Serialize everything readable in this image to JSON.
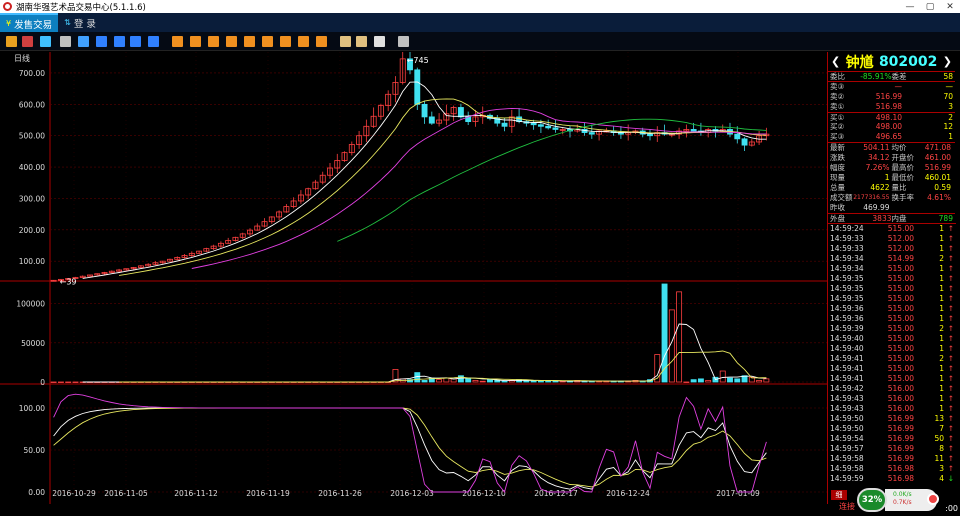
{
  "window": {
    "title": "湖南华强艺术品交易中心(5.1.1.6)",
    "controls": [
      "—",
      "▢",
      "✕"
    ]
  },
  "menu": {
    "items": [
      {
        "label": "发售交易",
        "icon": "¥"
      },
      {
        "label": "登  录",
        "icon": "⇅"
      }
    ]
  },
  "toolbar": {
    "buttons": [
      {
        "name": "bar-chart-icon",
        "color": "#e8a020"
      },
      {
        "name": "line-chart-icon",
        "color": "#d04040"
      },
      {
        "name": "candle-icon",
        "color": "#40c0ff"
      },
      {
        "name": "calc-icon",
        "color": "#c0c0c0"
      },
      {
        "name": "grid-icon",
        "color": "#40a0ff"
      },
      {
        "name": "k1-icon",
        "color": "#3080ff"
      },
      {
        "name": "k2-icon",
        "color": "#3080ff"
      },
      {
        "name": "k3-icon",
        "color": "#3080ff"
      },
      {
        "name": "k4-icon",
        "color": "#3080ff"
      },
      {
        "name": "p1-icon",
        "color": "#f09020"
      },
      {
        "name": "p2-icon",
        "color": "#f09020"
      },
      {
        "name": "p3-icon",
        "color": "#f09020"
      },
      {
        "name": "p4-icon",
        "color": "#f09020"
      },
      {
        "name": "p5-icon",
        "color": "#f09020"
      },
      {
        "name": "p6-icon",
        "color": "#f09020"
      },
      {
        "name": "p7-icon",
        "color": "#f09020"
      },
      {
        "name": "p8-icon",
        "color": "#f09020"
      },
      {
        "name": "p9-icon",
        "color": "#f09020"
      },
      {
        "name": "zoom-in-icon",
        "color": "#e0c080"
      },
      {
        "name": "zoom-out-icon",
        "color": "#e0c080"
      },
      {
        "name": "draw-icon",
        "color": "#e0e0e0"
      },
      {
        "name": "settings-icon",
        "color": "#c0c0c0"
      }
    ]
  },
  "product": {
    "name": "钟馗",
    "code": "802002"
  },
  "order_book": {
    "wei_bi_label": "委比",
    "wei_bi": "-85.91%",
    "wei_cha_label": "委差",
    "wei_cha": "58",
    "sell": [
      {
        "label": "卖③",
        "price": "—",
        "qty": "—"
      },
      {
        "label": "卖②",
        "price": "516.99",
        "qty": "70"
      },
      {
        "label": "卖①",
        "price": "516.98",
        "qty": "3"
      }
    ],
    "buy": [
      {
        "label": "买①",
        "price": "498.10",
        "qty": "2"
      },
      {
        "label": "买②",
        "price": "498.00",
        "qty": "12"
      },
      {
        "label": "买③",
        "price": "496.65",
        "qty": "1"
      }
    ]
  },
  "stats": [
    {
      "k1": "最新",
      "v1": "504.11",
      "k2": "均价",
      "v2": "471.08"
    },
    {
      "k1": "涨跌",
      "v1": "34.12",
      "k2": "开盘价",
      "v2": "461.00"
    },
    {
      "k1": "幅度",
      "v1": "7.26%",
      "k2": "最高价",
      "v2": "516.99"
    },
    {
      "k1": "现量",
      "v1": "1",
      "k2": "最低价",
      "v2": "460.01"
    },
    {
      "k1": "总量",
      "v1": "4622",
      "k2": "量比",
      "v2": "0.59"
    },
    {
      "k1": "成交额",
      "v1": "2177316.55",
      "k2": "换手率",
      "v2": "4.61%"
    },
    {
      "k1": "昨收",
      "v1": "469.99",
      "k2": "",
      "v2": ""
    }
  ],
  "outer_inner": {
    "out_label": "外盘",
    "out_val": "3833",
    "in_label": "内盘",
    "in_val": "789"
  },
  "trades": [
    {
      "time": "14:59:24",
      "price": "515.00",
      "vol": "1",
      "dir": "up"
    },
    {
      "time": "14:59:33",
      "price": "512.00",
      "vol": "1",
      "dir": "up"
    },
    {
      "time": "14:59:33",
      "price": "512.00",
      "vol": "1",
      "dir": "up"
    },
    {
      "time": "14:59:34",
      "price": "514.99",
      "vol": "2",
      "dir": "up"
    },
    {
      "time": "14:59:34",
      "price": "515.00",
      "vol": "1",
      "dir": "up"
    },
    {
      "time": "14:59:35",
      "price": "515.00",
      "vol": "1",
      "dir": "up"
    },
    {
      "time": "14:59:35",
      "price": "515.00",
      "vol": "1",
      "dir": "up"
    },
    {
      "time": "14:59:35",
      "price": "515.00",
      "vol": "1",
      "dir": "up"
    },
    {
      "time": "14:59:36",
      "price": "515.00",
      "vol": "1",
      "dir": "up"
    },
    {
      "time": "14:59:36",
      "price": "515.00",
      "vol": "1",
      "dir": "up"
    },
    {
      "time": "14:59:39",
      "price": "515.00",
      "vol": "2",
      "dir": "up"
    },
    {
      "time": "14:59:40",
      "price": "515.00",
      "vol": "1",
      "dir": "up"
    },
    {
      "time": "14:59:40",
      "price": "515.00",
      "vol": "1",
      "dir": "up"
    },
    {
      "time": "14:59:41",
      "price": "515.00",
      "vol": "2",
      "dir": "up"
    },
    {
      "time": "14:59:41",
      "price": "515.00",
      "vol": "1",
      "dir": "up"
    },
    {
      "time": "14:59:41",
      "price": "515.00",
      "vol": "1",
      "dir": "up"
    },
    {
      "time": "14:59:42",
      "price": "516.00",
      "vol": "1",
      "dir": "up"
    },
    {
      "time": "14:59:43",
      "price": "516.00",
      "vol": "1",
      "dir": "up"
    },
    {
      "time": "14:59:43",
      "price": "516.00",
      "vol": "1",
      "dir": "up"
    },
    {
      "time": "14:59:50",
      "price": "516.99",
      "vol": "13",
      "dir": "up"
    },
    {
      "time": "14:59:50",
      "price": "516.99",
      "vol": "7",
      "dir": "up"
    },
    {
      "time": "14:59:54",
      "price": "516.99",
      "vol": "50",
      "dir": "up"
    },
    {
      "time": "14:59:57",
      "price": "516.99",
      "vol": "8",
      "dir": "up"
    },
    {
      "time": "14:59:58",
      "price": "516.99",
      "vol": "11",
      "dir": "up"
    },
    {
      "time": "14:59:58",
      "price": "516.98",
      "vol": "3",
      "dir": "up"
    },
    {
      "time": "14:59:59",
      "price": "516.98",
      "vol": "4",
      "dir": "down"
    }
  ],
  "footer": {
    "tab": "细",
    "label": "连接",
    "gauge": "32%",
    "net_up": "0.0K/s",
    "net_down": "0.7K/s",
    "clock": ":00"
  },
  "chart_data": {
    "type": "candlestick",
    "period_label": "日线",
    "x_ticks": [
      "2016-10-29",
      "2016-11-05",
      "2016-11-12",
      "2016-11-19",
      "2016-11-26",
      "2016-12-03",
      "2016-12-10",
      "2016-12-17",
      "2016-12-24",
      "2017-01-09"
    ],
    "price_axis": {
      "ticks": [
        "700.00",
        "600.00",
        "500.00",
        "400.00",
        "300.00",
        "200.00",
        "100.00"
      ],
      "values": [
        700,
        600,
        500,
        400,
        300,
        200,
        100
      ],
      "min": 40,
      "max": 735
    },
    "volume_axis": {
      "ticks": [
        "100000",
        "50000",
        "0"
      ],
      "values": [
        100000,
        50000,
        0
      ],
      "max": 125000
    },
    "osc_axis": {
      "ticks": [
        "100.00",
        "50.00",
        "0.00"
      ],
      "values": [
        100,
        50,
        0
      ],
      "min": 0,
      "max": 125
    },
    "annotations": {
      "high": "745",
      "low": "39"
    },
    "closes": [
      39,
      42,
      45,
      48,
      52,
      56,
      60,
      64,
      68,
      72,
      76,
      80,
      85,
      90,
      95,
      100,
      106,
      112,
      118,
      125,
      132,
      140,
      148,
      157,
      166,
      176,
      187,
      199,
      212,
      226,
      241,
      257,
      274,
      292,
      311,
      331,
      352,
      374,
      397,
      421,
      446,
      472,
      500,
      530,
      562,
      596,
      632,
      670,
      745,
      710,
      600,
      560,
      540,
      550,
      570,
      590,
      560,
      545,
      560,
      565,
      555,
      540,
      530,
      560,
      545,
      540,
      535,
      530,
      525,
      520,
      520,
      515,
      520,
      510,
      505,
      515,
      515,
      510,
      505,
      510,
      515,
      505,
      500,
      510,
      505,
      505,
      515,
      520,
      515,
      510,
      520,
      515,
      520,
      505,
      490,
      470,
      480,
      500,
      505
    ],
    "volumes": [
      0,
      0,
      0,
      0,
      0,
      0,
      0,
      0,
      0,
      0,
      0,
      0,
      0,
      0,
      0,
      0,
      0,
      0,
      0,
      0,
      0,
      0,
      0,
      0,
      0,
      0,
      0,
      0,
      0,
      0,
      0,
      0,
      0,
      0,
      0,
      0,
      0,
      0,
      0,
      0,
      0,
      0,
      0,
      0,
      0,
      0,
      0,
      16000,
      4000,
      3000,
      12000,
      2000,
      5000,
      3000,
      5000,
      4000,
      8000,
      5000,
      2000,
      1000,
      3000,
      2000,
      1000,
      2000,
      3000,
      2000,
      2000,
      1000,
      2000,
      1000,
      1000,
      1000,
      2000,
      1000,
      1000,
      1000,
      1000,
      1000,
      1000,
      1000,
      2000,
      1000,
      3000,
      35000,
      125000,
      92000,
      115000,
      0,
      3000,
      4000,
      2000,
      6000,
      14000,
      5000,
      4000,
      8000,
      6000,
      2000,
      4000
    ]
  }
}
